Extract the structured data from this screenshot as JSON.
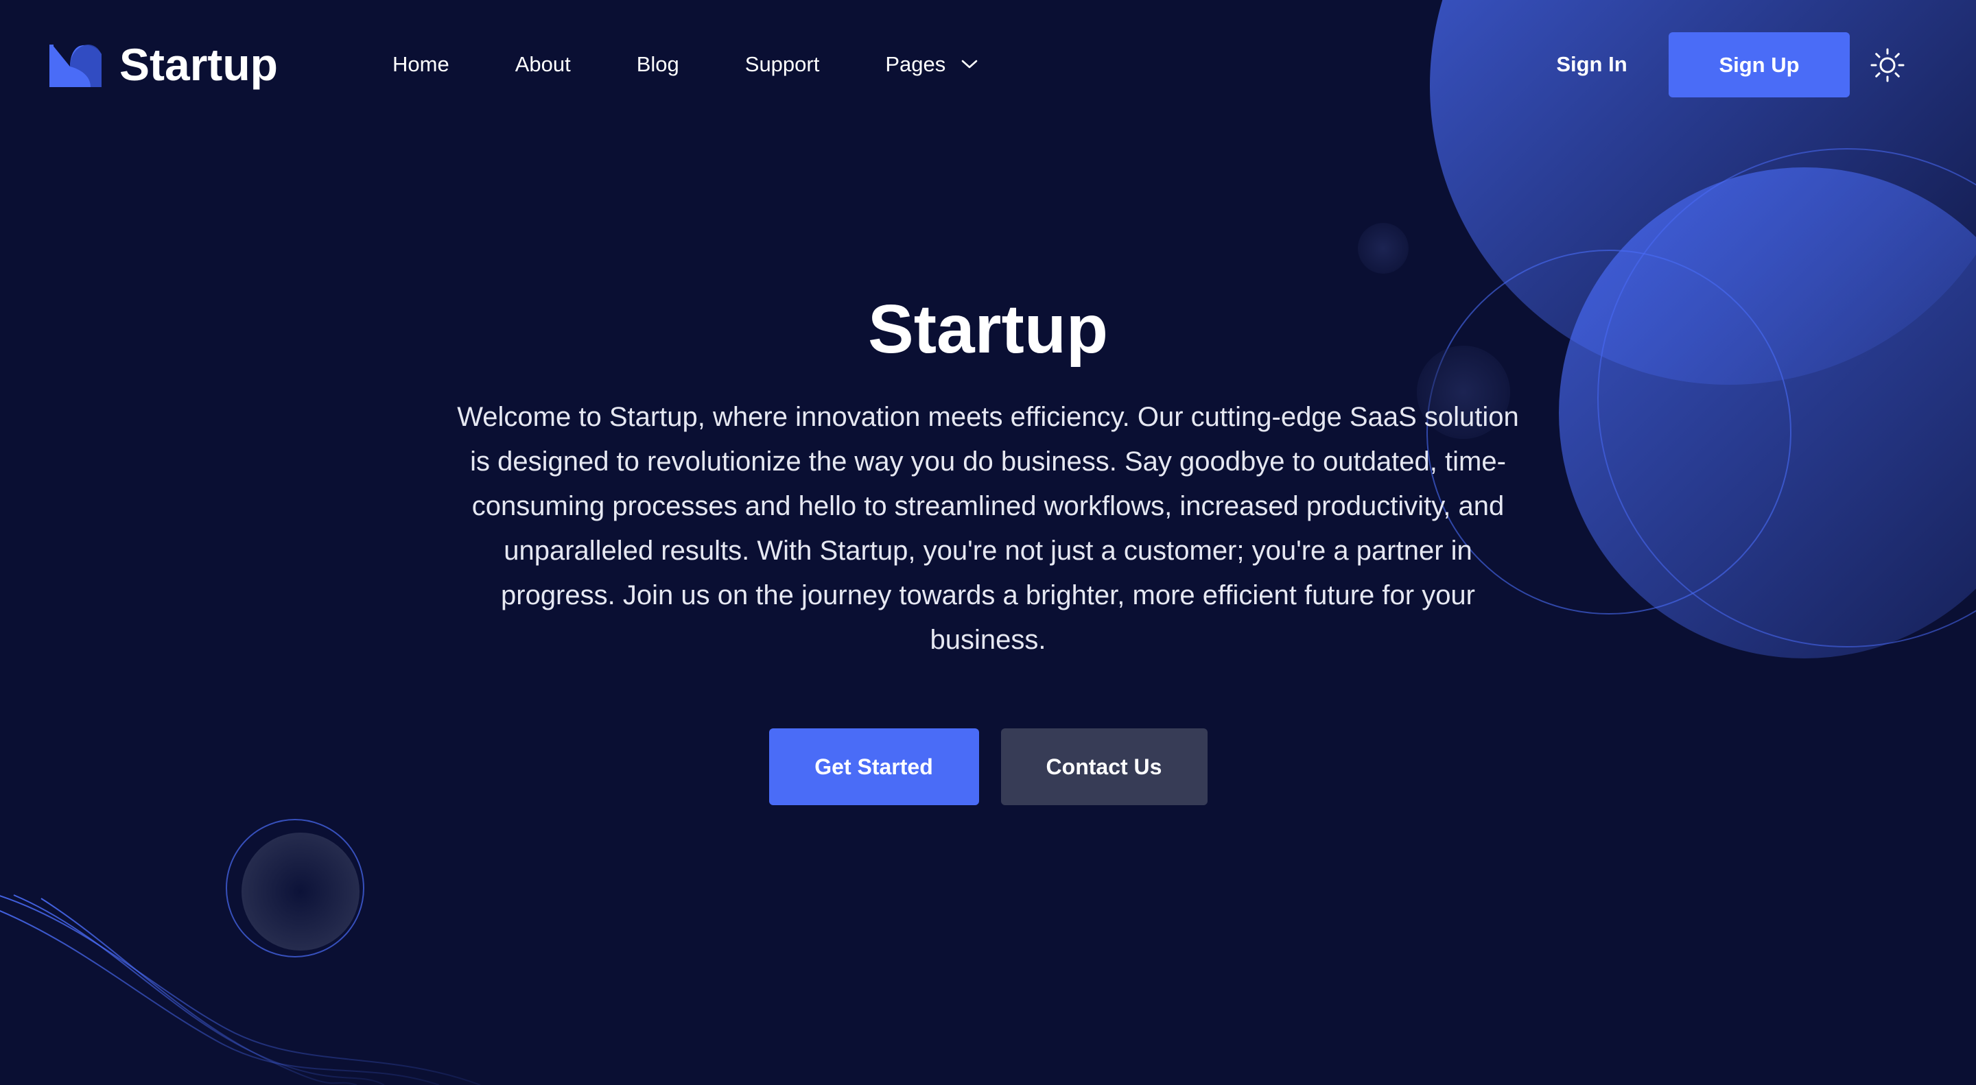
{
  "header": {
    "logo_text": "Startup",
    "nav": [
      {
        "label": "Home"
      },
      {
        "label": "About"
      },
      {
        "label": "Blog"
      },
      {
        "label": "Support"
      },
      {
        "label": "Pages"
      }
    ],
    "sign_in_label": "Sign In",
    "sign_up_label": "Sign Up"
  },
  "hero": {
    "title": "Startup",
    "description": "Welcome to Startup, where innovation meets efficiency. Our cutting-edge SaaS solution is designed to revolutionize the way you do business. Say goodbye to outdated, time-consuming processes and hello to streamlined workflows, increased productivity, and unparalleled results. With Startup, you're not just a customer; you're a partner in progress. Join us on the journey towards a brighter, more efficient future for your business.",
    "primary_button": "Get Started",
    "secondary_button": "Contact Us"
  },
  "icons": {
    "logo": "startup-logo-icon",
    "pages_dropdown": "chevron-down-icon",
    "theme_toggle": "sun-icon"
  },
  "colors": {
    "background": "#0a0f33",
    "accent": "#4a6cf7",
    "secondary_button": "#373c56",
    "text": "#ffffff"
  }
}
